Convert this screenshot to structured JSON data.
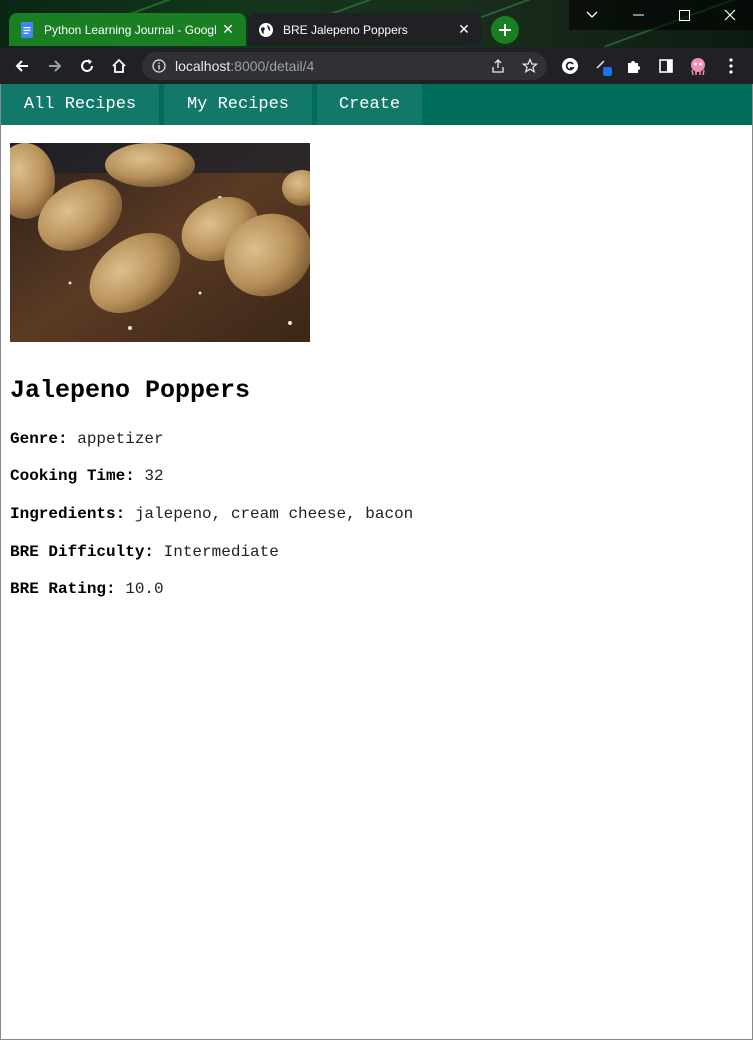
{
  "browser": {
    "tabs": [
      {
        "title": "Python Learning Journal - Googl",
        "favicon": "google-docs-icon",
        "active": false
      },
      {
        "title": "BRE Jalepeno Poppers",
        "favicon": "globe-icon",
        "active": true
      }
    ],
    "url_host": "localhost",
    "url_path": ":8000/detail/4",
    "accent": "#1a7e22"
  },
  "nav": {
    "all_recipes": "All Recipes",
    "my_recipes": "My Recipes",
    "create": "Create",
    "color": "#006d5b"
  },
  "recipe": {
    "name": "Jalepeno Poppers",
    "image": "breaded-jalapeno-poppers-photo",
    "fields": [
      {
        "label": "Genre",
        "value": "appetizer"
      },
      {
        "label": "Cooking Time",
        "value": "32"
      },
      {
        "label": "Ingredients",
        "value": "jalepeno, cream cheese, bacon"
      },
      {
        "label": "BRE Difficulty",
        "value": "Intermediate"
      },
      {
        "label": "BRE Rating",
        "value": "10.0"
      }
    ]
  }
}
